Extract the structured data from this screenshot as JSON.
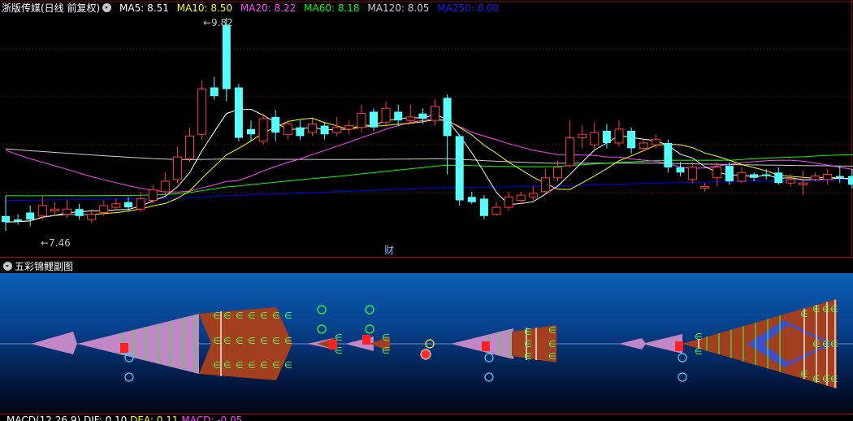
{
  "header": {
    "stock_title": "浙版传媒(日线 前复权)",
    "ma5": "MA5: 8.51",
    "ma10": "MA10: 8.50",
    "ma20": "MA20: 8.22",
    "ma60": "MA60: 8.18",
    "ma120": "MA120: 8.05",
    "ma250": "MA250: 8.00"
  },
  "colors": {
    "bg": "#000000",
    "up": "#ff3c3c",
    "down": "#54ffff",
    "ma5": "#ffffff",
    "ma10": "#ffff00",
    "ma20": "#ff44ff",
    "ma60": "#00ff00",
    "ma120": "#cccccc",
    "ma250": "#0000ff",
    "sub_fill_pink": "#c086c6",
    "sub_fill_brown": "#a23f1e",
    "sub_green": "#55ff55"
  },
  "annotations": {
    "high_label": "9.82",
    "low_label": "7.46",
    "cai_label": "财"
  },
  "subchart": {
    "title": "五彩锦鲤副图"
  },
  "bottom_panel": {
    "macd_title": "MACD(12,26,9)",
    "dif": "DIF: 0.10",
    "dea": "DEA: 0.11",
    "macd": "MACD: -0.05"
  },
  "chart_data": {
    "type": "candlestick",
    "price_range": [
      7.3,
      9.9
    ],
    "candles": [
      [
        7.62,
        7.55,
        7.85,
        7.45
      ],
      [
        7.58,
        7.56,
        7.64,
        7.52
      ],
      [
        7.66,
        7.58,
        7.74,
        7.5
      ],
      [
        7.62,
        7.74,
        7.86,
        7.58
      ],
      [
        7.68,
        7.7,
        7.78,
        7.62
      ],
      [
        7.64,
        7.7,
        7.8,
        7.6
      ],
      [
        7.7,
        7.62,
        7.76,
        7.58
      ],
      [
        7.58,
        7.64,
        7.7,
        7.54
      ],
      [
        7.66,
        7.74,
        7.8,
        7.62
      ],
      [
        7.72,
        7.76,
        7.82,
        7.68
      ],
      [
        7.78,
        7.72,
        7.84,
        7.68
      ],
      [
        7.7,
        7.82,
        7.9,
        7.66
      ],
      [
        7.8,
        7.92,
        7.98,
        7.76
      ],
      [
        7.9,
        8.02,
        8.12,
        7.86
      ],
      [
        8.04,
        8.3,
        8.42,
        8.0
      ],
      [
        8.28,
        8.54,
        8.64,
        8.24
      ],
      [
        8.56,
        9.08,
        9.18,
        8.5
      ],
      [
        9.1,
        9.0,
        9.22,
        8.96
      ],
      [
        9.82,
        9.08,
        9.9,
        8.94
      ],
      [
        9.1,
        8.52,
        9.14,
        8.48
      ],
      [
        8.62,
        8.56,
        8.72,
        8.48
      ],
      [
        8.48,
        8.74,
        8.8,
        8.44
      ],
      [
        8.76,
        8.58,
        8.84,
        8.48
      ],
      [
        8.56,
        8.68,
        8.72,
        8.5
      ],
      [
        8.64,
        8.54,
        8.72,
        8.5
      ],
      [
        8.58,
        8.68,
        8.74,
        8.54
      ],
      [
        8.66,
        8.56,
        8.7,
        8.5
      ],
      [
        8.58,
        8.64,
        8.76,
        8.54
      ],
      [
        8.62,
        8.66,
        8.72,
        8.56
      ],
      [
        8.64,
        8.8,
        8.9,
        8.58
      ],
      [
        8.82,
        8.64,
        8.86,
        8.6
      ],
      [
        8.7,
        8.86,
        8.94,
        8.64
      ],
      [
        8.82,
        8.72,
        8.9,
        8.66
      ],
      [
        8.72,
        8.76,
        8.9,
        8.68
      ],
      [
        8.8,
        8.74,
        8.86,
        8.68
      ],
      [
        8.72,
        8.88,
        8.96,
        8.66
      ],
      [
        8.98,
        8.54,
        9.02,
        8.1
      ],
      [
        8.54,
        7.8,
        8.56,
        7.74
      ],
      [
        7.84,
        7.78,
        7.9,
        7.76
      ],
      [
        7.82,
        7.62,
        7.86,
        7.58
      ],
      [
        7.64,
        7.72,
        7.78,
        7.62
      ],
      [
        7.72,
        7.84,
        7.9,
        7.68
      ],
      [
        7.8,
        7.86,
        7.9,
        7.76
      ],
      [
        7.84,
        7.88,
        7.96,
        7.8
      ],
      [
        7.9,
        8.06,
        8.16,
        7.88
      ],
      [
        8.06,
        8.18,
        8.26,
        8.02
      ],
      [
        8.2,
        8.52,
        8.72,
        8.18
      ],
      [
        8.52,
        8.56,
        8.66,
        8.4
      ],
      [
        8.44,
        8.58,
        8.7,
        8.4
      ],
      [
        8.6,
        8.46,
        8.68,
        8.4
      ],
      [
        8.46,
        8.62,
        8.72,
        8.42
      ],
      [
        8.6,
        8.4,
        8.64,
        8.34
      ],
      [
        8.4,
        8.46,
        8.5,
        8.36
      ],
      [
        8.44,
        8.5,
        8.56,
        8.4
      ],
      [
        8.46,
        8.18,
        8.5,
        8.12
      ],
      [
        8.18,
        8.12,
        8.24,
        8.08
      ],
      [
        8.04,
        8.18,
        8.24,
        8.0
      ],
      [
        7.94,
        7.96,
        8.0,
        7.9
      ],
      [
        8.06,
        8.18,
        8.24,
        7.96
      ],
      [
        8.2,
        8.02,
        8.24,
        7.98
      ],
      [
        8.02,
        8.12,
        8.18,
        8.0
      ],
      [
        8.1,
        8.06,
        8.12,
        8.02
      ],
      [
        8.1,
        8.08,
        8.16,
        8.04
      ],
      [
        8.12,
        8.0,
        8.18,
        7.98
      ],
      [
        8.0,
        8.04,
        8.1,
        7.96
      ],
      [
        7.98,
        8.0,
        8.14,
        7.86
      ],
      [
        8.04,
        8.08,
        8.12,
        8.02
      ],
      [
        8.04,
        8.1,
        8.16,
        7.98
      ],
      [
        8.08,
        8.06,
        8.2,
        8.0
      ],
      [
        8.08,
        7.98,
        8.16,
        7.94
      ],
      [
        7.92,
        8.08,
        8.14,
        7.9
      ],
      [
        8.18,
        8.04,
        8.22,
        8.02
      ],
      [
        7.98,
        8.08,
        8.14,
        7.94
      ],
      [
        8.08,
        8.12,
        8.18,
        8.02
      ],
      [
        8.14,
        8.18,
        8.38,
        8.08
      ],
      [
        8.2,
        8.26,
        8.6,
        8.18
      ],
      [
        8.34,
        8.42,
        8.54,
        8.3
      ],
      [
        8.46,
        8.6,
        8.72,
        8.36
      ],
      [
        8.7,
        8.54,
        8.74,
        8.44
      ],
      [
        8.52,
        8.58,
        8.68,
        8.44
      ],
      [
        8.68,
        8.6,
        8.76,
        8.5
      ],
      [
        8.56,
        8.66,
        8.8,
        8.52
      ],
      [
        8.64,
        8.72,
        8.9,
        8.58
      ],
      [
        8.72,
        8.64,
        8.8,
        8.58
      ],
      [
        8.64,
        8.58,
        8.7,
        8.54
      ],
      [
        8.58,
        8.62,
        8.72,
        8.54
      ],
      [
        8.62,
        8.52,
        8.66,
        8.48
      ]
    ]
  }
}
